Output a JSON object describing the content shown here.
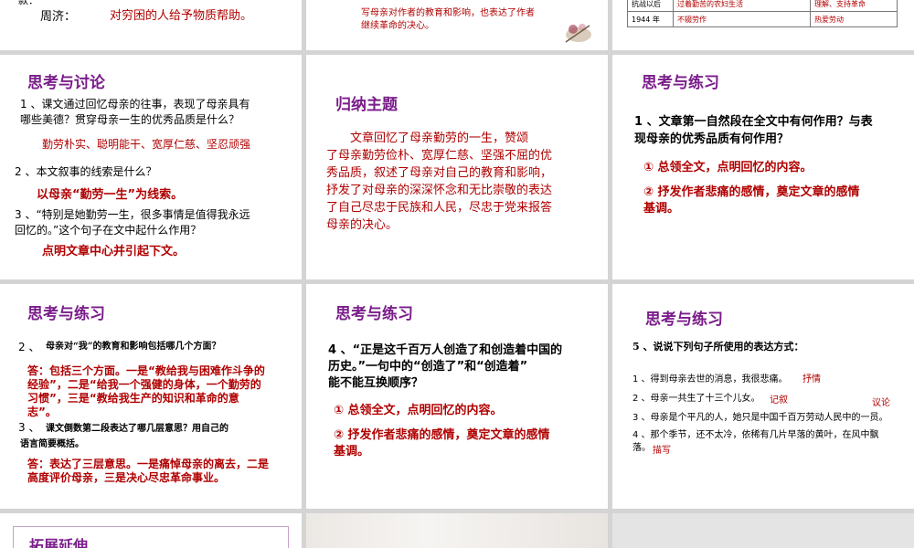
{
  "row0": {
    "left": {
      "label": "周济：",
      "answer": "对穷困的人给予物质帮助。"
    },
    "middle": {
      "text": "写母亲对作者的教育和影响，也表达了作者\n继续革命的决心。"
    },
    "right": {
      "rows": [
        {
          "period": "抗战以后",
          "event": "过着勤苦的农妇生活",
          "quality": "理解、支持革命"
        },
        {
          "period": "1944 年",
          "event": "不辍劳作",
          "quality": "热爱劳动"
        }
      ]
    }
  },
  "slide_discuss": {
    "heading": "思考与讨论",
    "q1": "1 、课文通过回忆母亲的往事，表现了母亲具有\n哪些美德？贯穿母亲一生的优秀品质是什么？",
    "a1": "勤劳朴实、聪明能干、宽厚仁慈、坚忍顽强",
    "q2": "2 、本文叙事的线索是什么？",
    "a2": "以母亲“勤劳一生”为线索。",
    "q3": "3 、“特别是她勤劳一生，很多事情是值得我永远\n回忆的。”这个句子在文中起什么作用？",
    "a3": "点明文章中心并引起下文。"
  },
  "slide_theme": {
    "heading": "归纳主题",
    "body": "　　文章回忆了母亲勤劳的一生，赞颂\n了母亲勤劳俭朴、宽厚仁慈、坚强不屈的优\n秀品质，叙述了母亲对自己的教育和影响，\n抒发了对母亲的深深怀念和无比崇敬的表达\n了自己尽忠于民族和人民，尽忠于党来报答\n母亲的决心。"
  },
  "slide_practice1": {
    "heading": "思考与练习",
    "q": "1 、文章第一自然段在全文中有何作用？与表\n现母亲的优秀品质有何作用？",
    "a1": "① 总领全文，点明回忆的内容。",
    "a2": "② 抒发作者悲痛的感情，奠定文章的感情\n基调。"
  },
  "slide_practice2": {
    "heading": "思考与练习",
    "q2_num": "2 、",
    "q2": "母亲对“我”的教育和影响包括哪几个方面？",
    "a2": "答：包括三个方面。一是“教给我与困难作斗争的\n经验”，二是“给我一个强健的身体，一个勤劳的\n习惯”，三是“教给我生产的知识和革命的意\n志”。",
    "q3_num": "3 、",
    "q3": "课文倒数第二段表达了哪几层意思？用自己的\n语言简要概括。",
    "a3": "答：表达了三层意思。一是痛悼母亲的离去，二是\n高度评价母亲，三是决心尽忠革命事业。"
  },
  "slide_practice3": {
    "heading": "思考与练习",
    "q": "4 、“正是这千百万人创造了和创造着中国的\n历史。”一句中的“创造了”和“创造着”\n能不能互换顺序？",
    "a1": "① 总领全文，点明回忆的内容。",
    "a2": "② 抒发作者悲痛的感情，奠定文章的感情\n基调。"
  },
  "slide_practice4": {
    "heading": "思考与练习",
    "q": "5 、说说下列句子所使用的表达方式：",
    "s1": "1 、得到母亲去世的消息，我很悲痛。",
    "s1_ans": "抒情",
    "s2": "2 、母亲一共生了十三个儿女。",
    "s2_ans": "记叙",
    "s3_ans": "议论",
    "s3": "3 、母亲是个平凡的人，她只是中国千百万劳动人民中的一员。",
    "s4": "4 、那个季节，还不太冷，依稀有几片早落的黄叶，在风中飘\n落。",
    "s4_ans": "描写"
  },
  "slide_extend": {
    "heading": "拓展延伸"
  }
}
